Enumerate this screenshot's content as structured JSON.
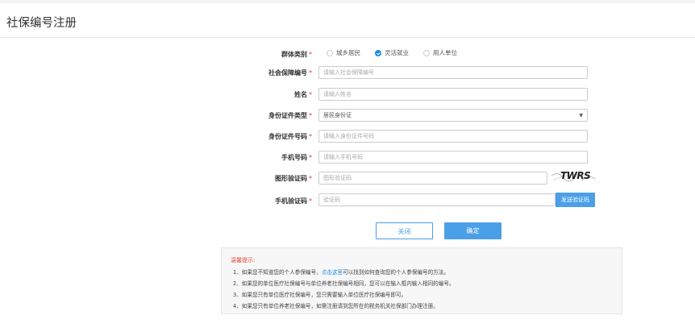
{
  "page": {
    "title": "社保编号注册"
  },
  "form": {
    "group_type": {
      "label": "群体类别",
      "options": [
        "城乡居民",
        "灵活就业",
        "用人单位"
      ],
      "selected": "灵活就业"
    },
    "social_security_no": {
      "label": "社会保障编号",
      "placeholder": "请输入社会保障编号"
    },
    "name": {
      "label": "姓名",
      "placeholder": "请输入姓名"
    },
    "id_type": {
      "label": "身份证件类型",
      "value": "居民身份证"
    },
    "id_no": {
      "label": "身份证件号码",
      "placeholder": "请输入身份证件号码"
    },
    "phone": {
      "label": "手机号码",
      "placeholder": "请输入手机号码"
    },
    "image_captcha": {
      "label": "图形验证码",
      "placeholder": "图形验证码",
      "captcha_text": "TWRS"
    },
    "sms_captcha": {
      "label": "手机验证码",
      "placeholder": "验证码",
      "send_label": "发送验证码"
    },
    "required_mark": "*"
  },
  "actions": {
    "close_label": "关闭",
    "confirm_label": "确定"
  },
  "tips": {
    "title": "温馨提示:",
    "item1_prefix": "1、如果您不知道您的个人参保编号，",
    "item1_link": "点击这里",
    "item1_suffix": "可以找到如何查询您的个人参保编号的方法。",
    "item2": "2、如果您的单位医疗社保编号与单位养老社保编号相同，您可以在输入框内输入相同的编号。",
    "item3": "3、如果您只有单位医疗社保编号，您只需要输入单位医疗社保编号即可。",
    "item4": "4、如果您只有单位养老社保编号，如需注册请到您所在的税务机关社保部门办理注册。"
  },
  "colors": {
    "accent": "#4a9fe8",
    "required": "#e33333",
    "tips_title": "#e54c3c"
  }
}
